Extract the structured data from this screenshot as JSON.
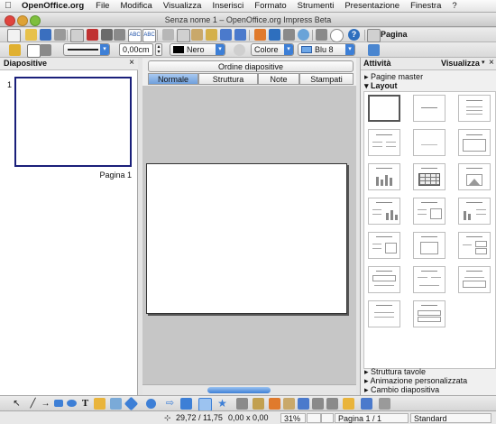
{
  "menubar": {
    "app_name": "OpenOffice.org",
    "items": [
      "File",
      "Modifica",
      "Visualizza",
      "Inserisci",
      "Formato",
      "Strumenti",
      "Presentazione",
      "Finestra",
      "?"
    ]
  },
  "window": {
    "title": "Senza nome 1 – OpenOffice.org Impress Beta"
  },
  "standard_toolbar": {
    "pagina_label": "Pagina"
  },
  "line_toolbar": {
    "line_width": "0,00cm",
    "line_color": "Nero",
    "area_style": "Colore",
    "area_color": "Blu 8",
    "accent": "#3d7fd6",
    "area_color_swatch": "#6fa8e8"
  },
  "slides_panel": {
    "title": "Diapositive",
    "close": "×",
    "slides": [
      {
        "number": "1",
        "label": "Pagina 1"
      }
    ]
  },
  "main_view": {
    "header_tab": "Ordine diapositive",
    "tabs": [
      "Normale",
      "Struttura",
      "Note",
      "Stampati"
    ],
    "active_tab": "Normale"
  },
  "tasks_panel": {
    "title": "Attività",
    "view_menu": "Visualizza",
    "close": "×",
    "sections": {
      "master": "Pagine master",
      "layout": "Layout",
      "table": "Struttura tavole",
      "animation": "Animazione personalizzata",
      "transition": "Cambio diapositiva"
    }
  },
  "statusbar": {
    "position": "29,72 / 11,75",
    "size": "0,00 x 0,00",
    "zoom": "31%",
    "page": "Pagina 1 / 1",
    "layout_name": "Standard"
  }
}
